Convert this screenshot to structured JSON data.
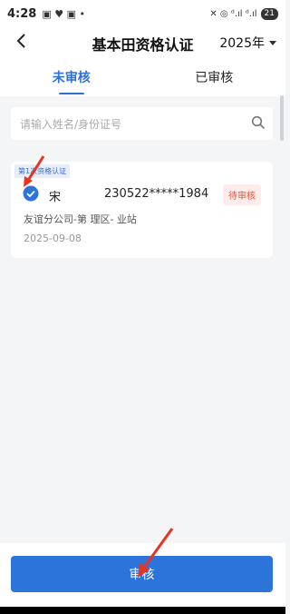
{
  "status_bar": {
    "time": "4:28",
    "left_icons": "▣ ♥ ▣ •",
    "right_icons": "✕ ◎ ᵈ.ıl ᵈ.ıl",
    "battery": "21"
  },
  "header": {
    "title": "基本田资格认证",
    "year": "2025年"
  },
  "tabs": [
    {
      "label": "未审核",
      "active": true
    },
    {
      "label": "已审核",
      "active": false
    }
  ],
  "search": {
    "placeholder": "请输入姓名/身份证号"
  },
  "records": [
    {
      "tag": "第1次资格认证",
      "name": "宋",
      "id_number": "230522*****1984",
      "status": "待审核",
      "org": "友谊分公司-第 理区-  业站",
      "date": "2025-09-08"
    }
  ],
  "actions": {
    "review_button": "审核"
  },
  "colors": {
    "accent": "#2e6fd8",
    "pending": "#e2563a",
    "arrow": "#e8331f"
  }
}
